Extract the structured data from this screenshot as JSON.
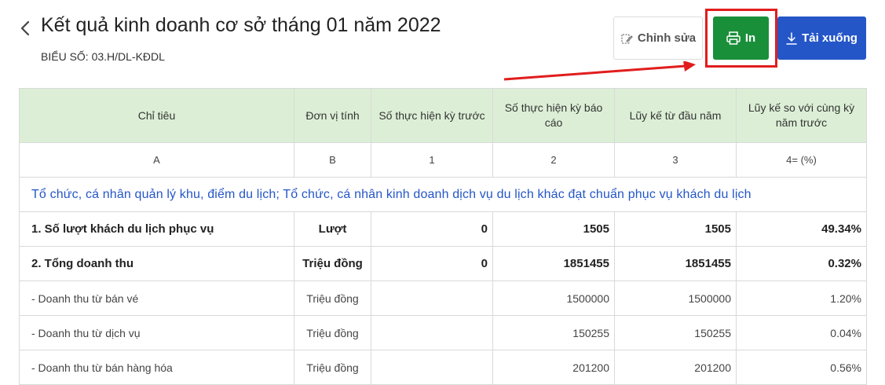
{
  "header": {
    "title": "Kết quả kinh doanh cơ sở tháng 01 năm 2022",
    "form_code": "BIỂU SỐ: 03.H/DL-KĐDL"
  },
  "toolbar": {
    "edit_label": "Chỉnh sửa",
    "print_label": "In",
    "download_label": "Tải xuống",
    "print_color": "#1a8f3a",
    "download_color": "#2456c8",
    "highlight_color": "#e11d1d"
  },
  "table": {
    "columns": [
      "Chỉ tiêu",
      "Đơn vị tính",
      "Số thực hiện kỳ trước",
      "Số thực hiện kỳ báo cáo",
      "Lũy kế từ đầu năm",
      "Lũy kế so với cùng kỳ năm trước"
    ],
    "index_row": [
      "A",
      "B",
      "1",
      "2",
      "3",
      "4= (%)"
    ],
    "section_title": "Tổ chức, cá nhân quản lý khu, điểm du lịch; Tổ chức, cá nhân kinh doanh dịch vụ du lịch khác đạt chuẩn phục vụ khách du lịch",
    "rows": [
      [
        "1. Số lượt khách du lịch phục vụ",
        "Lượt",
        "0",
        "1505",
        "1505",
        "49.34%"
      ],
      [
        "2. Tổng doanh thu",
        "Triệu đồng",
        "0",
        "1851455",
        "1851455",
        "0.32%"
      ],
      [
        "- Doanh thu từ bán vé",
        "Triệu đồng",
        "",
        "1500000",
        "1500000",
        "1.20%"
      ],
      [
        "- Doanh thu từ dịch vụ",
        "Triệu đồng",
        "",
        "150255",
        "150255",
        "0.04%"
      ],
      [
        "- Doanh thu từ bán hàng hóa",
        "Triệu đồng",
        "",
        "201200",
        "201200",
        "0.56%"
      ]
    ]
  }
}
